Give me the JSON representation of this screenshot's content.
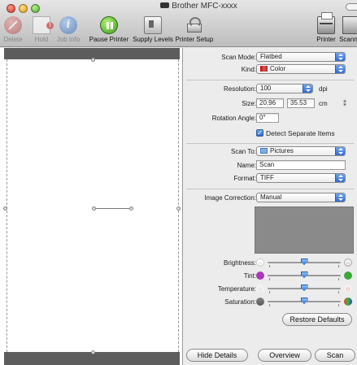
{
  "window": {
    "title": "Brother MFC-xxxx"
  },
  "toolbar": {
    "delete": "Delete",
    "hold": "Hold",
    "job_info": "Job Info",
    "pause_printer": "Pause Printer",
    "supply_levels": "Supply Levels",
    "printer_setup": "Printer Setup",
    "printer": "Printer",
    "scanner": "Scanner"
  },
  "settings": {
    "scan_mode": {
      "label": "Scan Mode:",
      "value": "Flatbed"
    },
    "kind": {
      "label": "Kind:",
      "value": "Color"
    },
    "resolution": {
      "label": "Resolution:",
      "value": "100",
      "unit": "dpi"
    },
    "size": {
      "label": "Size:",
      "width": "20.96",
      "height": "35.53",
      "unit": "cm",
      "lock_glyph": "⁑"
    },
    "rotation": {
      "label": "Rotation Angle:",
      "value": "0°"
    },
    "detect_separate": {
      "label": "Detect Separate Items",
      "checked": true,
      "check_glyph": "✓"
    },
    "scan_to": {
      "label": "Scan To:",
      "value": "Pictures"
    },
    "name": {
      "label": "Name:",
      "value": "Scan"
    },
    "format": {
      "label": "Format:",
      "value": "TIFF"
    },
    "image_correction": {
      "label": "Image Correction:",
      "value": "Manual"
    }
  },
  "sliders": {
    "brightness": {
      "label": "Brightness:",
      "level": 0.5
    },
    "tint": {
      "label": "Tint:",
      "level": 0.5
    },
    "temperature": {
      "label": "Temperature:",
      "level": 0.5
    },
    "saturation": {
      "label": "Saturation:",
      "level": 0.5
    }
  },
  "glyphs": {
    "sun": "☼"
  },
  "buttons": {
    "restore_defaults": "Restore Defaults",
    "hide_details": "Hide Details",
    "overview": "Overview",
    "scan": "Scan"
  },
  "colors": {
    "accent": "#2f6bd0",
    "preview_bar": "#5d5d5d",
    "histogram": "#8a8a8a"
  }
}
